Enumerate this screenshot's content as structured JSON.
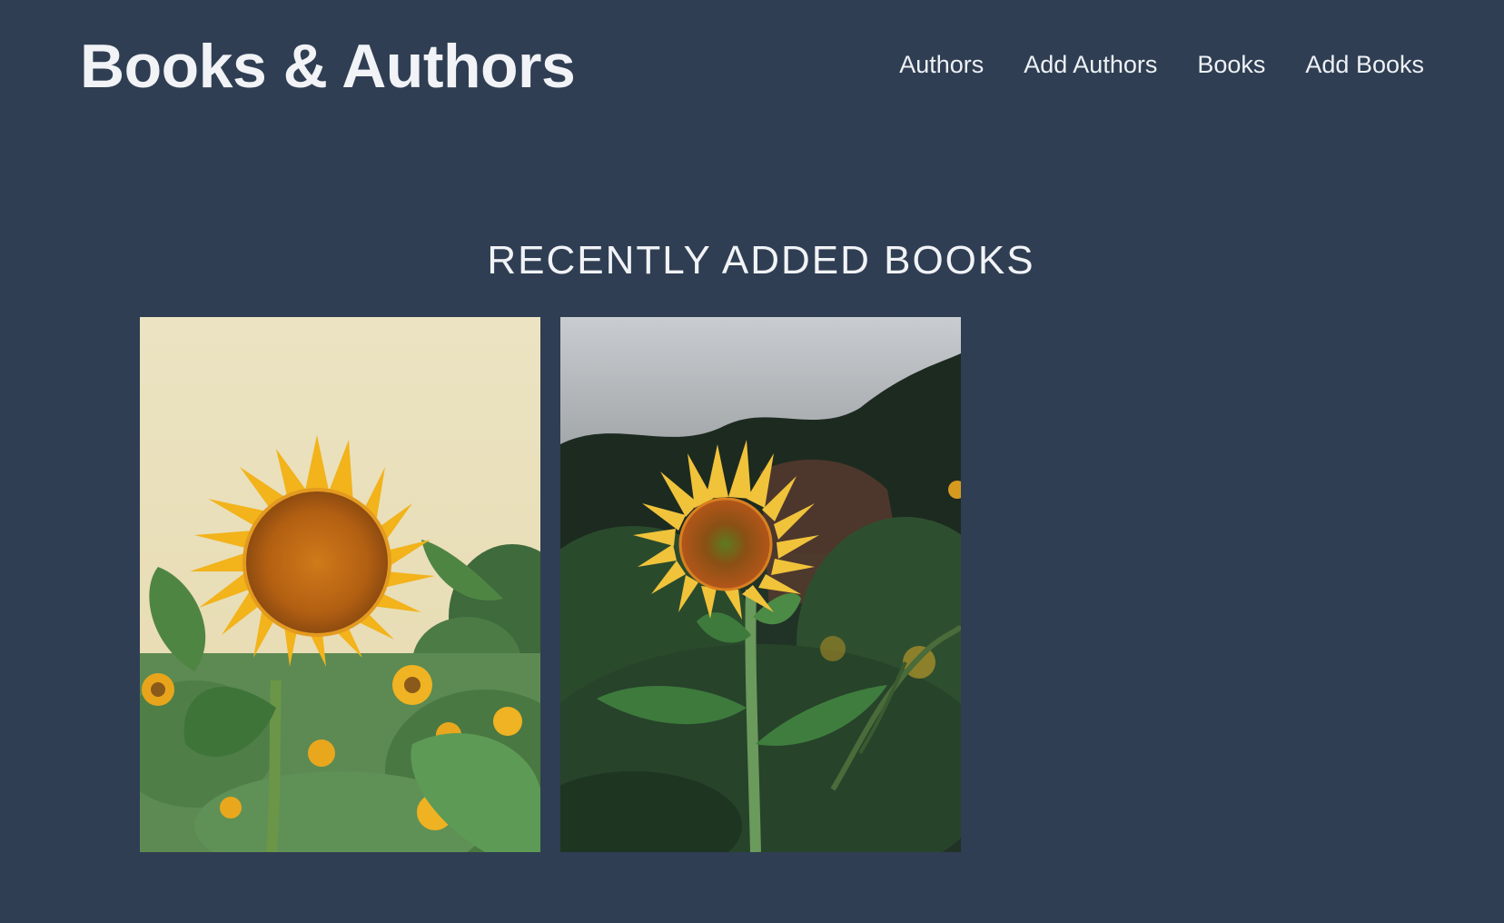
{
  "header": {
    "brand": "Books & Authors",
    "nav": [
      {
        "label": "Authors"
      },
      {
        "label": "Add Authors"
      },
      {
        "label": "Books"
      },
      {
        "label": "Add Books"
      }
    ]
  },
  "main": {
    "section_title": "RECENTLY ADDED BOOKS",
    "books": [
      {
        "cover": "sunflower-field-pale-sky"
      },
      {
        "cover": "sunflower-dark-forest"
      }
    ]
  },
  "colors": {
    "background": "#2f3e53",
    "text": "#eef1f5"
  }
}
